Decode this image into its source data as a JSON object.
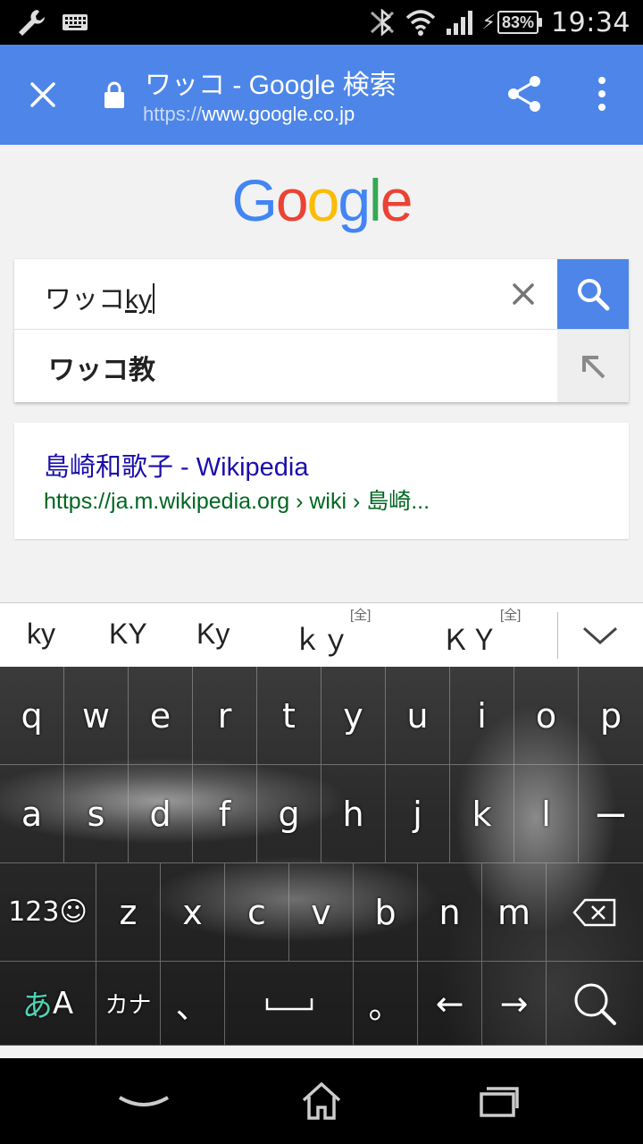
{
  "status_bar": {
    "time": "19:34",
    "battery": "83%",
    "icons": [
      "wrench-icon",
      "keyboard-icon",
      "nfc-icon",
      "wifi-icon",
      "signal-icon",
      "charging-icon",
      "battery-icon"
    ]
  },
  "toolbar": {
    "title": "ワッコ - Google 検索",
    "url_scheme": "https://",
    "url_host": "www.google.co.jp",
    "accent": "#4d86e8"
  },
  "google_logo": {
    "letters": [
      "G",
      "o",
      "o",
      "g",
      "l",
      "e"
    ],
    "colors": [
      "#4285f4",
      "#ea4335",
      "#fbbc05",
      "#4285f4",
      "#34a853",
      "#ea4335"
    ]
  },
  "search": {
    "committed_text": "ワッコ",
    "composing_text": "ky"
  },
  "suggestion": {
    "text": "ワッコ教"
  },
  "result": {
    "title": "島崎和歌子 - Wikipedia",
    "url": "https://ja.m.wikipedia.org › wiki › 島崎..."
  },
  "candidates": [
    {
      "label": "ky",
      "tag": ""
    },
    {
      "label": "KY",
      "tag": ""
    },
    {
      "label": "Ky",
      "tag": ""
    },
    {
      "label": "ｋｙ",
      "tag": "[全]"
    },
    {
      "label": "ＫＹ",
      "tag": "[全]"
    }
  ],
  "keyboard": {
    "row1": [
      "q",
      "w",
      "e",
      "r",
      "t",
      "y",
      "u",
      "i",
      "o",
      "p"
    ],
    "row2": [
      "a",
      "s",
      "d",
      "f",
      "g",
      "h",
      "j",
      "k",
      "l",
      "ー"
    ],
    "row3": [
      "123☺",
      "z",
      "x",
      "c",
      "v",
      "b",
      "n",
      "m"
    ],
    "row4_mode_kana": "あ",
    "row4_mode_alpha": "A",
    "row4_katakana": "カナ",
    "row4_comma": "、",
    "row4_period": "。",
    "row4_left": "←",
    "row4_right": "→"
  }
}
